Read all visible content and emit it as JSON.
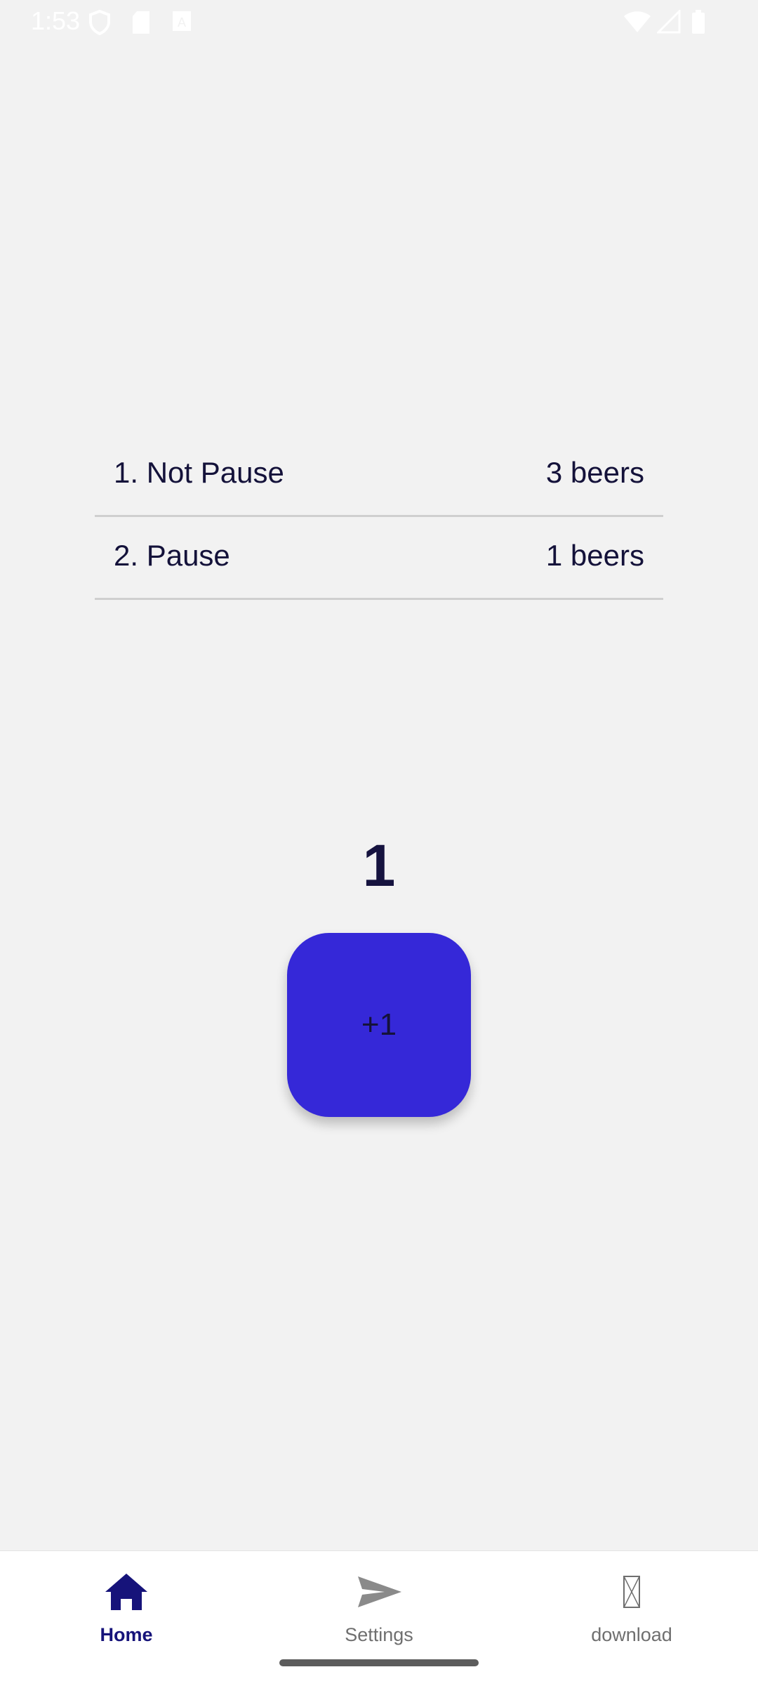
{
  "status_bar": {
    "time": "1:53"
  },
  "leaderboard": {
    "items": [
      {
        "name": "1. Not Pause",
        "count": "3 beers"
      },
      {
        "name": "2. Pause",
        "count": "1 beers"
      }
    ]
  },
  "counter": {
    "value": "1",
    "button_label": "+1"
  },
  "bottom_nav": {
    "items": [
      {
        "label": "Home",
        "icon": "home-icon",
        "active": true
      },
      {
        "label": "Settings",
        "icon": "send-icon",
        "active": false
      },
      {
        "label": "download",
        "icon": "broken-image-icon",
        "active": false
      }
    ]
  },
  "colors": {
    "background": "#f2f2f2",
    "accent": "#3528d8",
    "nav_active": "#16137a",
    "nav_inactive": "#6f6f6f"
  }
}
